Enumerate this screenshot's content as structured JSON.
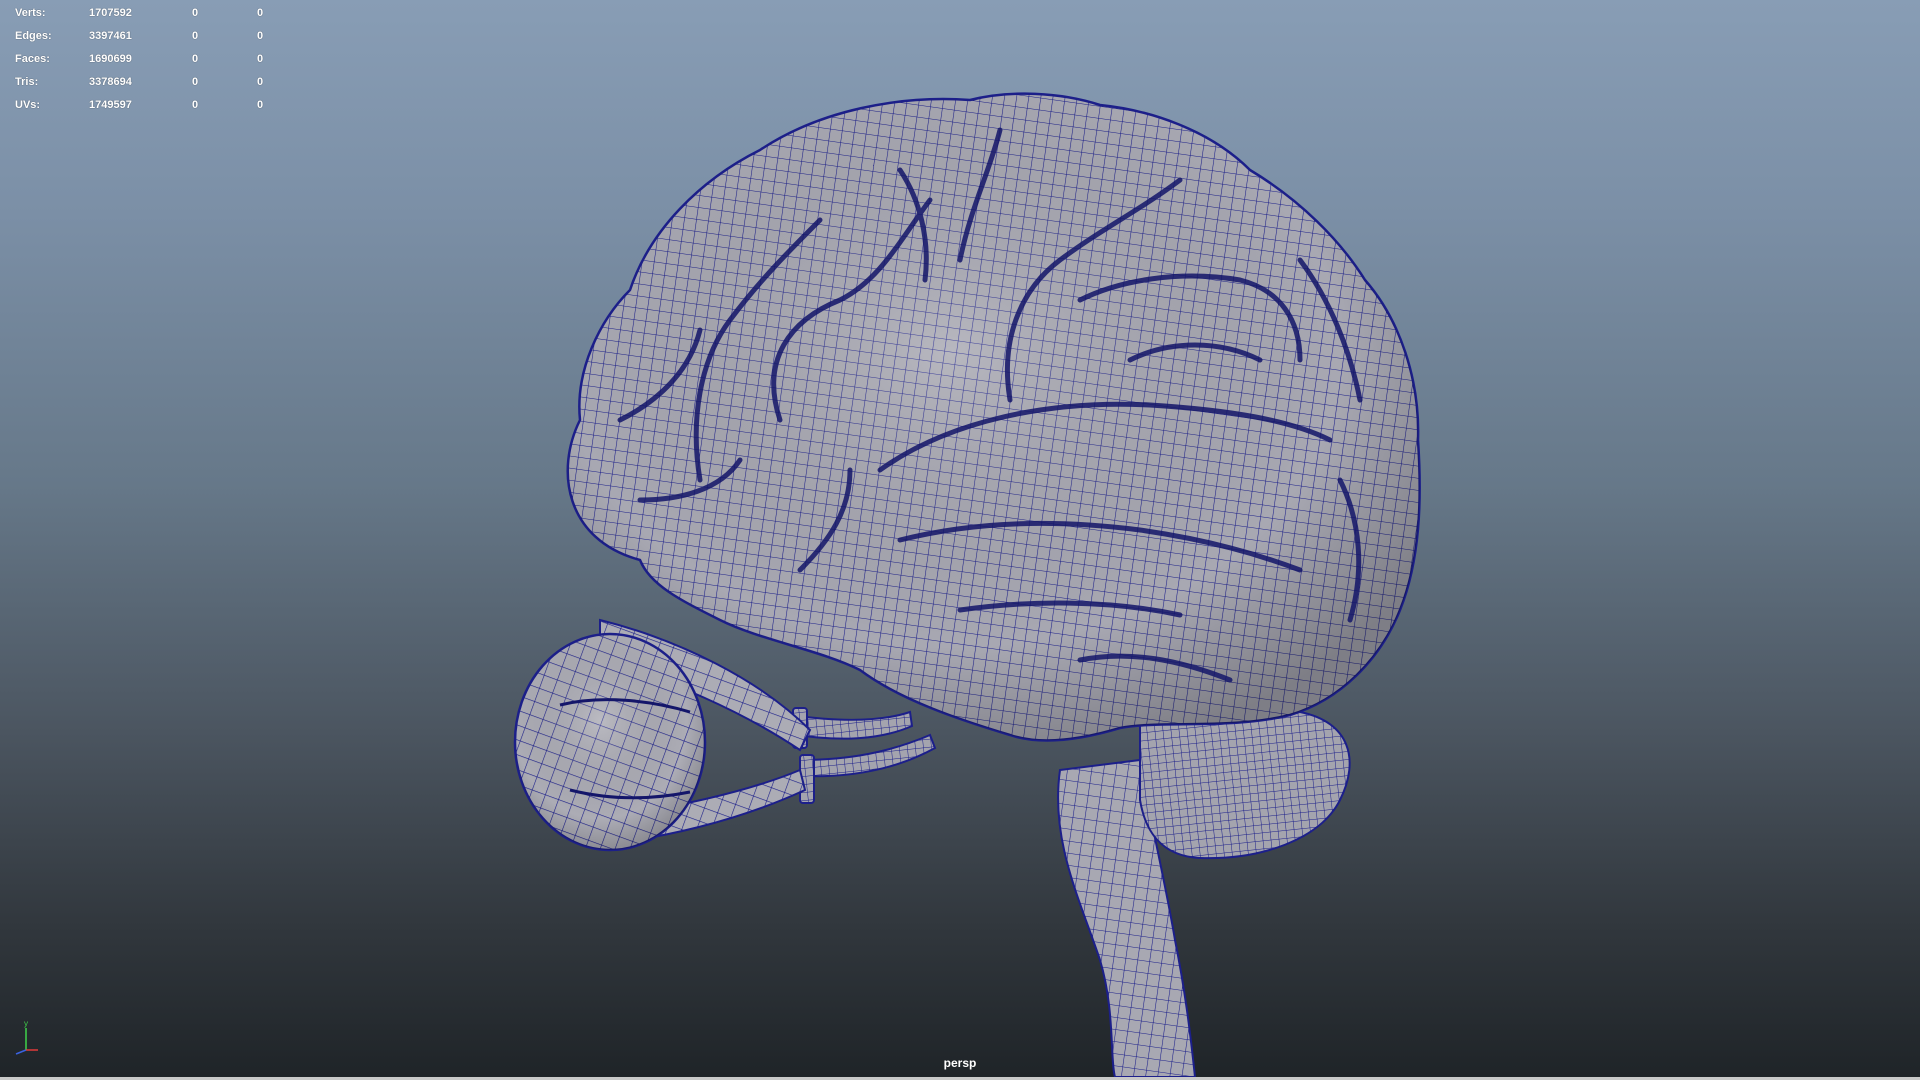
{
  "viewport": {
    "camera": "persp",
    "background_top": "#889db5",
    "background_bottom": "#1f2428",
    "wire_color": "#1c1f8a",
    "surface_color": "#a9a9b3"
  },
  "hud": {
    "rows": [
      {
        "label": "Verts:",
        "value": "1707592",
        "c1": "0",
        "c2": "0"
      },
      {
        "label": "Edges:",
        "value": "3397461",
        "c1": "0",
        "c2": "0"
      },
      {
        "label": "Faces:",
        "value": "1690699",
        "c1": "0",
        "c2": "0"
      },
      {
        "label": "Tris:",
        "value": "3378694",
        "c1": "0",
        "c2": "0"
      },
      {
        "label": "UVs:",
        "value": "1749597",
        "c1": "0",
        "c2": "0"
      }
    ]
  },
  "axis": {
    "y_label": "y",
    "icon": "xyz-axis-gizmo-icon"
  }
}
